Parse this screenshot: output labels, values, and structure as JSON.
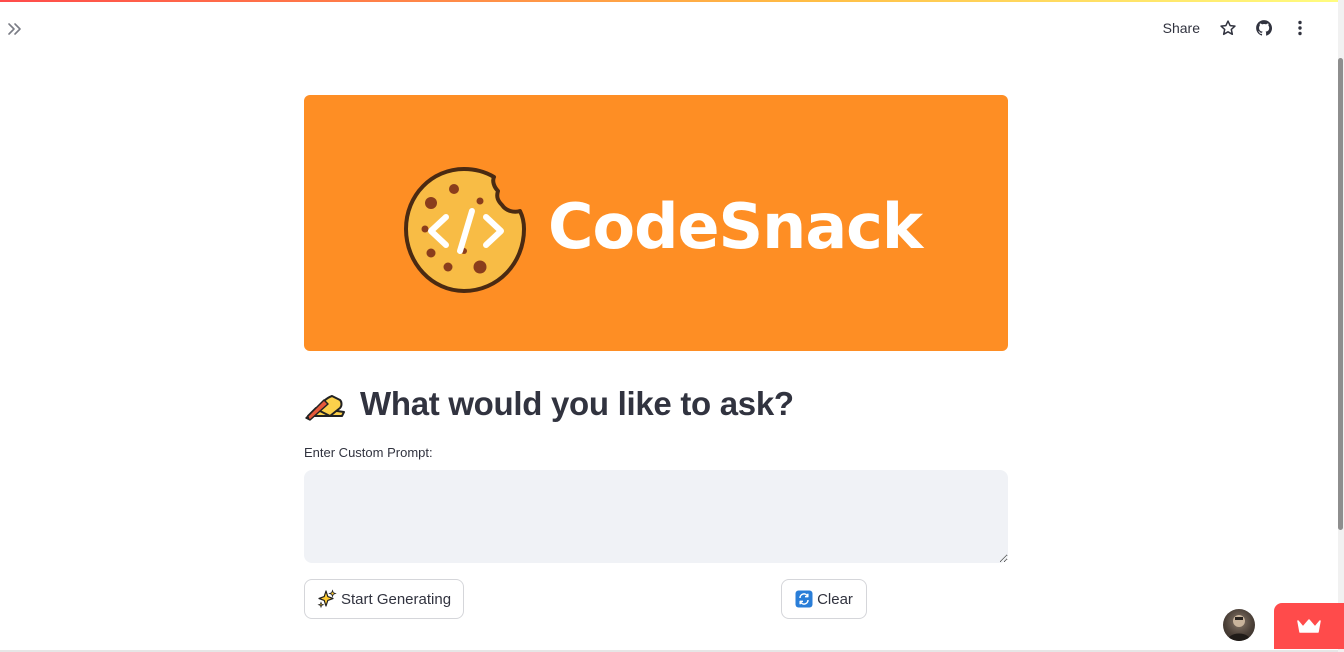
{
  "header": {
    "share_label": "Share",
    "icons": [
      "chevrons-right-icon",
      "star-icon",
      "github-icon",
      "more-vertical-icon"
    ]
  },
  "banner": {
    "brand_name": "CodeSnack",
    "background_color": "#fe8e24",
    "logo_icon": "cookie-code-icon"
  },
  "main": {
    "heading_icon": "writing-hand-icon",
    "heading": "What would you like to ask?",
    "prompt_label": "Enter Custom Prompt:",
    "prompt_value": "",
    "start_icon": "sparkles-icon",
    "start_label": "Start Generating",
    "clear_icon": "refresh-icon",
    "clear_label": "Clear"
  },
  "footer": {
    "badge_icon": "crown-icon",
    "badge_color": "#ff4b4b"
  }
}
